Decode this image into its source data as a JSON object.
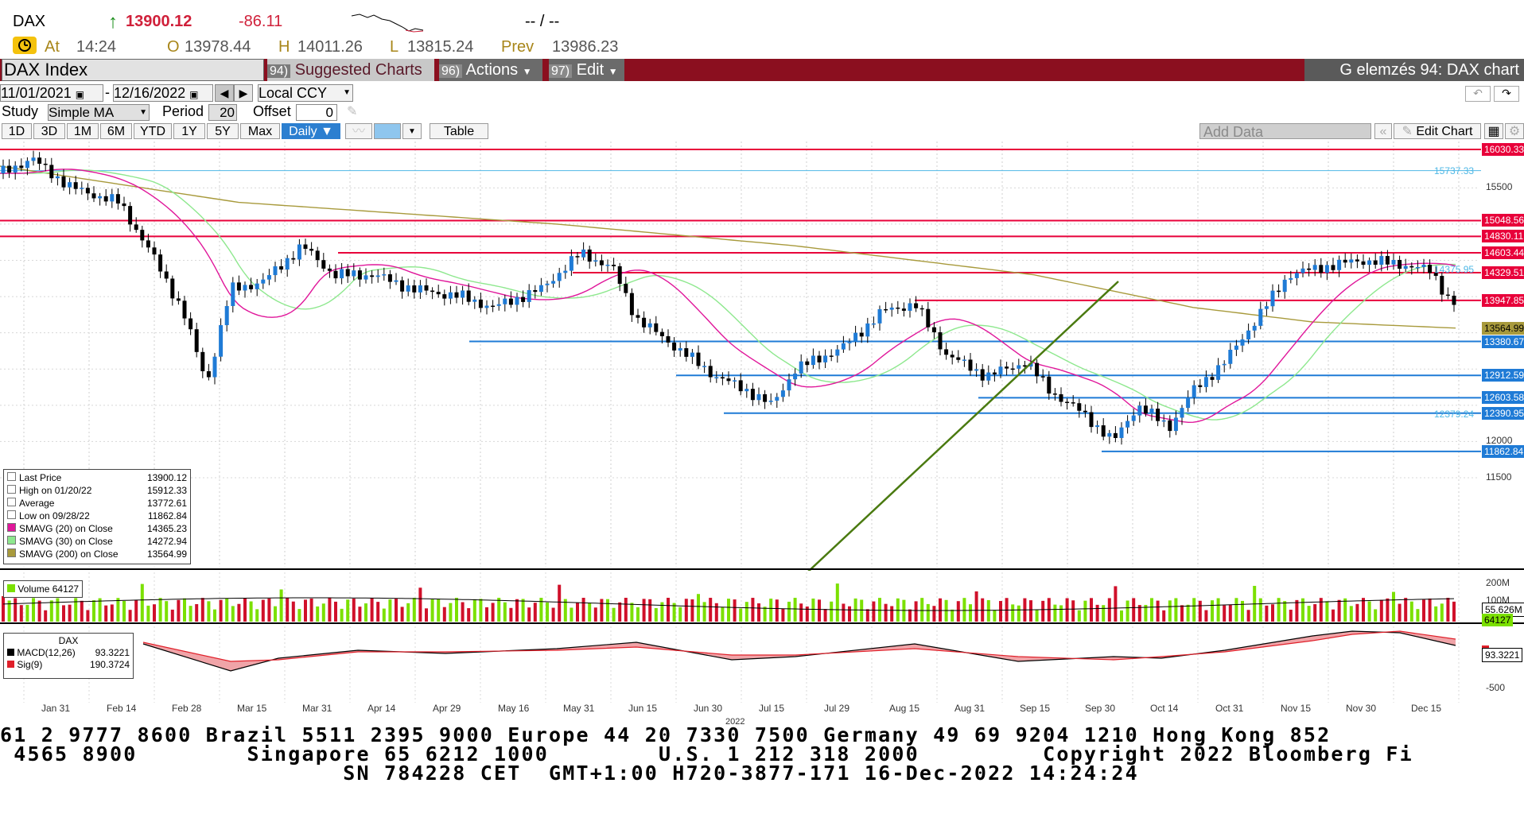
{
  "ticker": {
    "symbol": "DAX",
    "arrow": "↑",
    "last": "13900.12",
    "change": "-86.11",
    "time_placeholder": "-- / --",
    "at_label": "At",
    "at_time": "14:24",
    "open_label": "O",
    "open": "13978.44",
    "high_label": "H",
    "high": "14011.26",
    "low_label": "L",
    "low": "13815.24",
    "prev_label": "Prev",
    "prev": "13986.23"
  },
  "toolbar": {
    "security": "DAX Index",
    "suggested_num": "94)",
    "suggested": "Suggested Charts",
    "actions_num": "96)",
    "actions": "Actions",
    "edit_num": "97)",
    "edit": "Edit",
    "title": "G elemzés 94: DAX chart"
  },
  "dates": {
    "start": "11/01/2021",
    "sep": "-",
    "end": "12/16/2022",
    "currency": "Local CCY"
  },
  "study": {
    "label": "Study",
    "type": "Simple MA",
    "period_label": "Period",
    "period": "20",
    "offset_label": "Offset",
    "offset": "0"
  },
  "ranges": [
    "1D",
    "3D",
    "1M",
    "6M",
    "YTD",
    "1Y",
    "5Y",
    "Max"
  ],
  "frequency": "Daily ▼",
  "table_label": "Table",
  "add_data_placeholder": "Add Data",
  "edit_chart": "Edit Chart",
  "price_tags": [
    {
      "text": "16030.33",
      "value": 16030.33,
      "color": "#e8003a"
    },
    {
      "text": "15737.33",
      "value": 15737.33,
      "color": "#4fb8e6"
    },
    {
      "text": "15048.56",
      "value": 15048.56,
      "color": "#e8003a"
    },
    {
      "text": "14830.11",
      "value": 14830.11,
      "color": "#e8003a"
    },
    {
      "text": "14603.44",
      "value": 14603.44,
      "color": "#e8003a"
    },
    {
      "text": "14375.95",
      "value": 14375.95,
      "color": "#4fb8e6"
    },
    {
      "text": "14329.51",
      "value": 14329.51,
      "color": "#e8003a"
    },
    {
      "text": "13947.85",
      "value": 13947.85,
      "color": "#e8003a"
    },
    {
      "text": "13564.99",
      "value": 13564.99,
      "color": "#a89a3c"
    },
    {
      "text": "13380.67",
      "value": 13380.67,
      "color": "#1f7bd6"
    },
    {
      "text": "12912.59",
      "value": 12912.59,
      "color": "#1f7bd6"
    },
    {
      "text": "12603.58",
      "value": 12603.58,
      "color": "#1f7bd6"
    },
    {
      "text": "12379.24",
      "value": 12379.24,
      "color": "#4fb8e6"
    },
    {
      "text": "12390.95",
      "value": 12390.95,
      "color": "#1f7bd6"
    },
    {
      "text": "11862.84",
      "value": 11862.84,
      "color": "#1f7bd6"
    }
  ],
  "y_ticks": [
    "15500",
    "12000",
    "11500"
  ],
  "legend": {
    "rows": [
      {
        "label": "Last Price",
        "value": "13900.12"
      },
      {
        "label": "High on 01/20/22",
        "value": "15912.33"
      },
      {
        "label": "Average",
        "value": "13772.61"
      },
      {
        "label": "Low on 09/28/22",
        "value": "11862.84"
      },
      {
        "label": "SMAVG (20)  on Close",
        "value": "14365.23",
        "color": "#e0169a"
      },
      {
        "label": "SMAVG (30)  on Close",
        "value": "14272.94",
        "color": "#8ee88e"
      },
      {
        "label": "SMAVG (200)  on Close",
        "value": "13564.99",
        "color": "#a89a3c"
      }
    ]
  },
  "volume": {
    "label": "Volume",
    "value": "64127",
    "ticks": [
      "200M",
      "100M"
    ],
    "tag1": "55.626M",
    "tag2": "64127"
  },
  "macd": {
    "title": "DAX",
    "macd_label": "MACD(12,26)",
    "macd_value": "93.3221",
    "sig_label": "Sig(9)",
    "sig_value": "190.3724",
    "tick": "-500",
    "tag": "93.3221"
  },
  "x_labels": [
    "Jan 31",
    "Feb 14",
    "Feb 28",
    "Mar 15",
    "Mar 31",
    "Apr 14",
    "Apr 29",
    "May 16",
    "May 31",
    "Jun 15",
    "Jun 30",
    "Jul 15",
    "Jul 29",
    "Aug 15",
    "Aug 31",
    "Sep 15",
    "Sep 30",
    "Oct 14",
    "Oct 31",
    "Nov 15",
    "Nov 30",
    "Dec 15"
  ],
  "x_year": "2022",
  "footer": {
    "line1": "61 2 9777 8600 Brazil 5511 2395 9000 Europe 44 20 7330 7500 Germany 49 69 9204 1210 Hong Kong 852",
    "line2": " 4565 8900        Singapore 65 6212 1000        U.S. 1 212 318 2000         Copyright 2022 Bloomberg Fi",
    "line3": "                         SN 784228 CET  GMT+1:00 H720-3877-171 16-Dec-2022 14:24:24"
  },
  "colors": {
    "up": "#1f7bd6",
    "down": "#000000",
    "resistance": "#e8003a",
    "support": "#1f7bd6",
    "sma20": "#e0169a",
    "sma30": "#8ee88e",
    "sma200": "#a89a3c",
    "trend": "#4a7a10",
    "toolbar_red": "#8b0f1f"
  }
}
